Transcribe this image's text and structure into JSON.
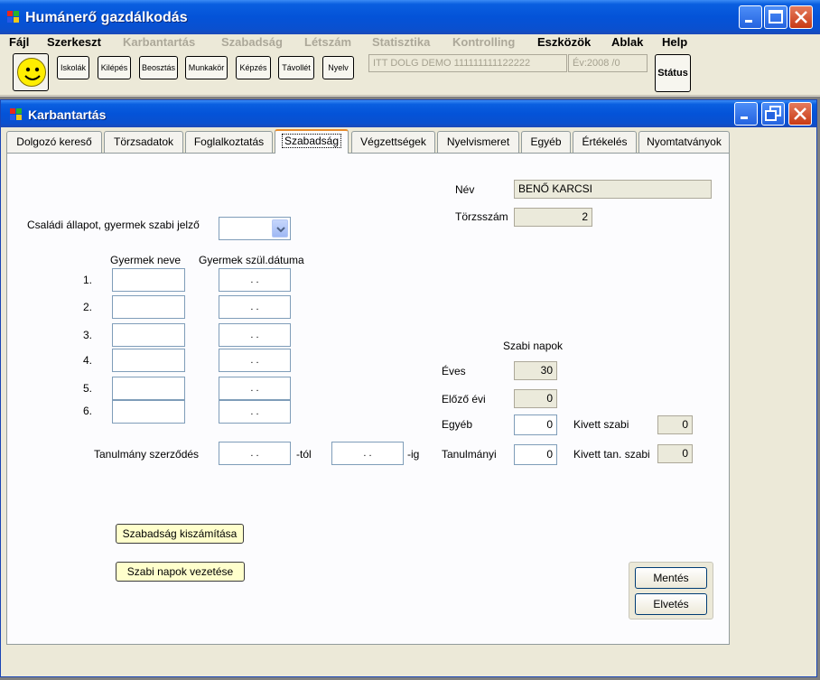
{
  "window": {
    "title": "Humánerő gazdálkodás"
  },
  "menu": [
    {
      "label": "Fájl",
      "enabled": true
    },
    {
      "label": "Szerkeszt",
      "enabled": true
    },
    {
      "label": "Karbantartás",
      "enabled": false
    },
    {
      "label": "Szabadság",
      "enabled": false
    },
    {
      "label": "Létszám",
      "enabled": false
    },
    {
      "label": "Statisztika",
      "enabled": false
    },
    {
      "label": "Kontrolling",
      "enabled": false
    },
    {
      "label": "Eszközök",
      "enabled": true
    },
    {
      "label": "Ablak",
      "enabled": true
    },
    {
      "label": "Help",
      "enabled": true
    }
  ],
  "toolbar": {
    "buttons": [
      "Iskolák",
      "Kilépés",
      "Beosztás",
      "Munkakör",
      "Képzés",
      "Távollét",
      "Nyelv"
    ],
    "db_name": "ITT DOLG DEMO 111111111122222",
    "year": "Év:2008  /0",
    "status_label": "Státus"
  },
  "child": {
    "title": "Karbantartás",
    "tabs": [
      "Dolgozó kereső",
      "Törzsadatok",
      "Foglalkoztatás",
      "Szabadság",
      "Végzettségek",
      "Nyelvismeret",
      "Egyéb",
      "Értékelés",
      "Nyomtatványok"
    ],
    "active_tab": "Szabadság"
  },
  "form": {
    "nev_label": "Név",
    "nev_value": "BENŐ KARCSI",
    "torzsszam_label": "Törzsszám",
    "torzsszam_value": "2",
    "csaladi_label": "Családi állapot, gyermek szabi jelző",
    "csaladi_value": "",
    "children_col_name": "Gyermek neve",
    "children_col_date": "Gyermek szül.dátuma",
    "children": [
      {
        "num": "1.",
        "name": "",
        "date": " .  ."
      },
      {
        "num": "2.",
        "name": "",
        "date": " .  ."
      },
      {
        "num": "3.",
        "name": "",
        "date": " .  ."
      },
      {
        "num": "4.",
        "name": "",
        "date": " .  ."
      },
      {
        "num": "5.",
        "name": "",
        "date": " .  ."
      },
      {
        "num": "6.",
        "name": "",
        "date": " .  ."
      }
    ],
    "tanulmany_label": "Tanulmány szerződés",
    "tanulmany_from": " .  .",
    "tol_label": "-tól",
    "tanulmany_to": " .  .",
    "ig_label": "-ig",
    "szabi_napok_label": "Szabi napok",
    "eves_label": "Éves",
    "eves_value": "30",
    "elozo_label": "Előző évi",
    "elozo_value": "0",
    "egyeb_label": "Egyéb",
    "egyeb_value": "0",
    "tanulmanyi_label": "Tanulmányi",
    "tanulmanyi_value": "0",
    "kivett_label": "Kivett szabi",
    "kivett_value": "0",
    "kivett_tan_label": "Kivett tan. szabi",
    "kivett_tan_value": "0",
    "btn_calc": "Szabadság kiszámítása",
    "btn_vezetes": "Szabi napok vezetése",
    "btn_save": "Mentés",
    "btn_discard": "Elvetés"
  }
}
